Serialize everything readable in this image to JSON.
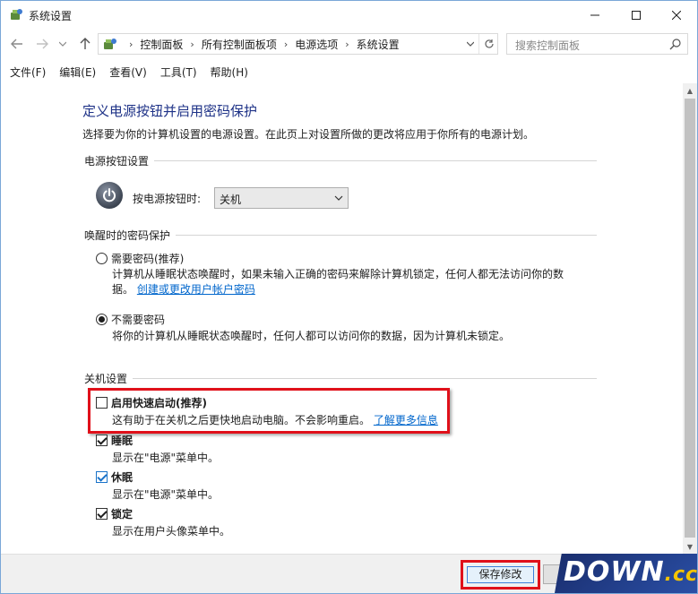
{
  "window": {
    "title": "系统设置",
    "minimize_glyph": "—",
    "maximize_glyph": "☐",
    "close_glyph": "✕"
  },
  "address": {
    "breadcrumbs": [
      "控制面板",
      "所有控制面板项",
      "电源选项",
      "系统设置"
    ],
    "search_placeholder": "搜索控制面板"
  },
  "menu": {
    "items": [
      "文件(F)",
      "编辑(E)",
      "查看(V)",
      "工具(T)",
      "帮助(H)"
    ]
  },
  "page": {
    "title": "定义电源按钮并启用密码保护",
    "description": "选择要为你的计算机设置的电源设置。在此页上对设置所做的更改将应用于你所有的电源计划。"
  },
  "power_button": {
    "section_label": "电源按钮设置",
    "label": "按电源按钮时:",
    "selected": "关机"
  },
  "wake_password": {
    "section_label": "唤醒时的密码保护",
    "require": {
      "label": "需要密码(推荐)",
      "desc_line1": "计算机从睡眠状态唤醒时，如果未输入正确的密码来解除计算机锁定，任何人都无法访问你的数",
      "desc_line2": "据。",
      "link": "创建或更改用户帐户密码",
      "checked": false
    },
    "no_require": {
      "label": "不需要密码",
      "desc": "将你的计算机从睡眠状态唤醒时，任何人都可以访问你的数据，因为计算机未锁定。",
      "checked": true
    }
  },
  "shutdown": {
    "section_label": "关机设置",
    "fast_startup": {
      "label": "启用快速启动(推荐)",
      "desc": "这有助于在关机之后更快地启动电脑。不会影响重启。",
      "link": "了解更多信息",
      "checked": false
    },
    "sleep": {
      "label": "睡眠",
      "desc": "显示在\"电源\"菜单中。",
      "checked": true
    },
    "hibernate": {
      "label": "休眠",
      "desc": "显示在\"电源\"菜单中。",
      "checked": true
    },
    "lock": {
      "label": "锁定",
      "desc": "显示在用户头像菜单中。",
      "checked": true
    }
  },
  "footer": {
    "save_label": "保存修改"
  },
  "watermark": {
    "main": "DOWN",
    "suffix": ".cc"
  },
  "colors": {
    "title_blue": "#1e3287",
    "link_blue": "#0066cc",
    "highlight_red": "#e0101a",
    "check_blue": "#1a73c9"
  }
}
